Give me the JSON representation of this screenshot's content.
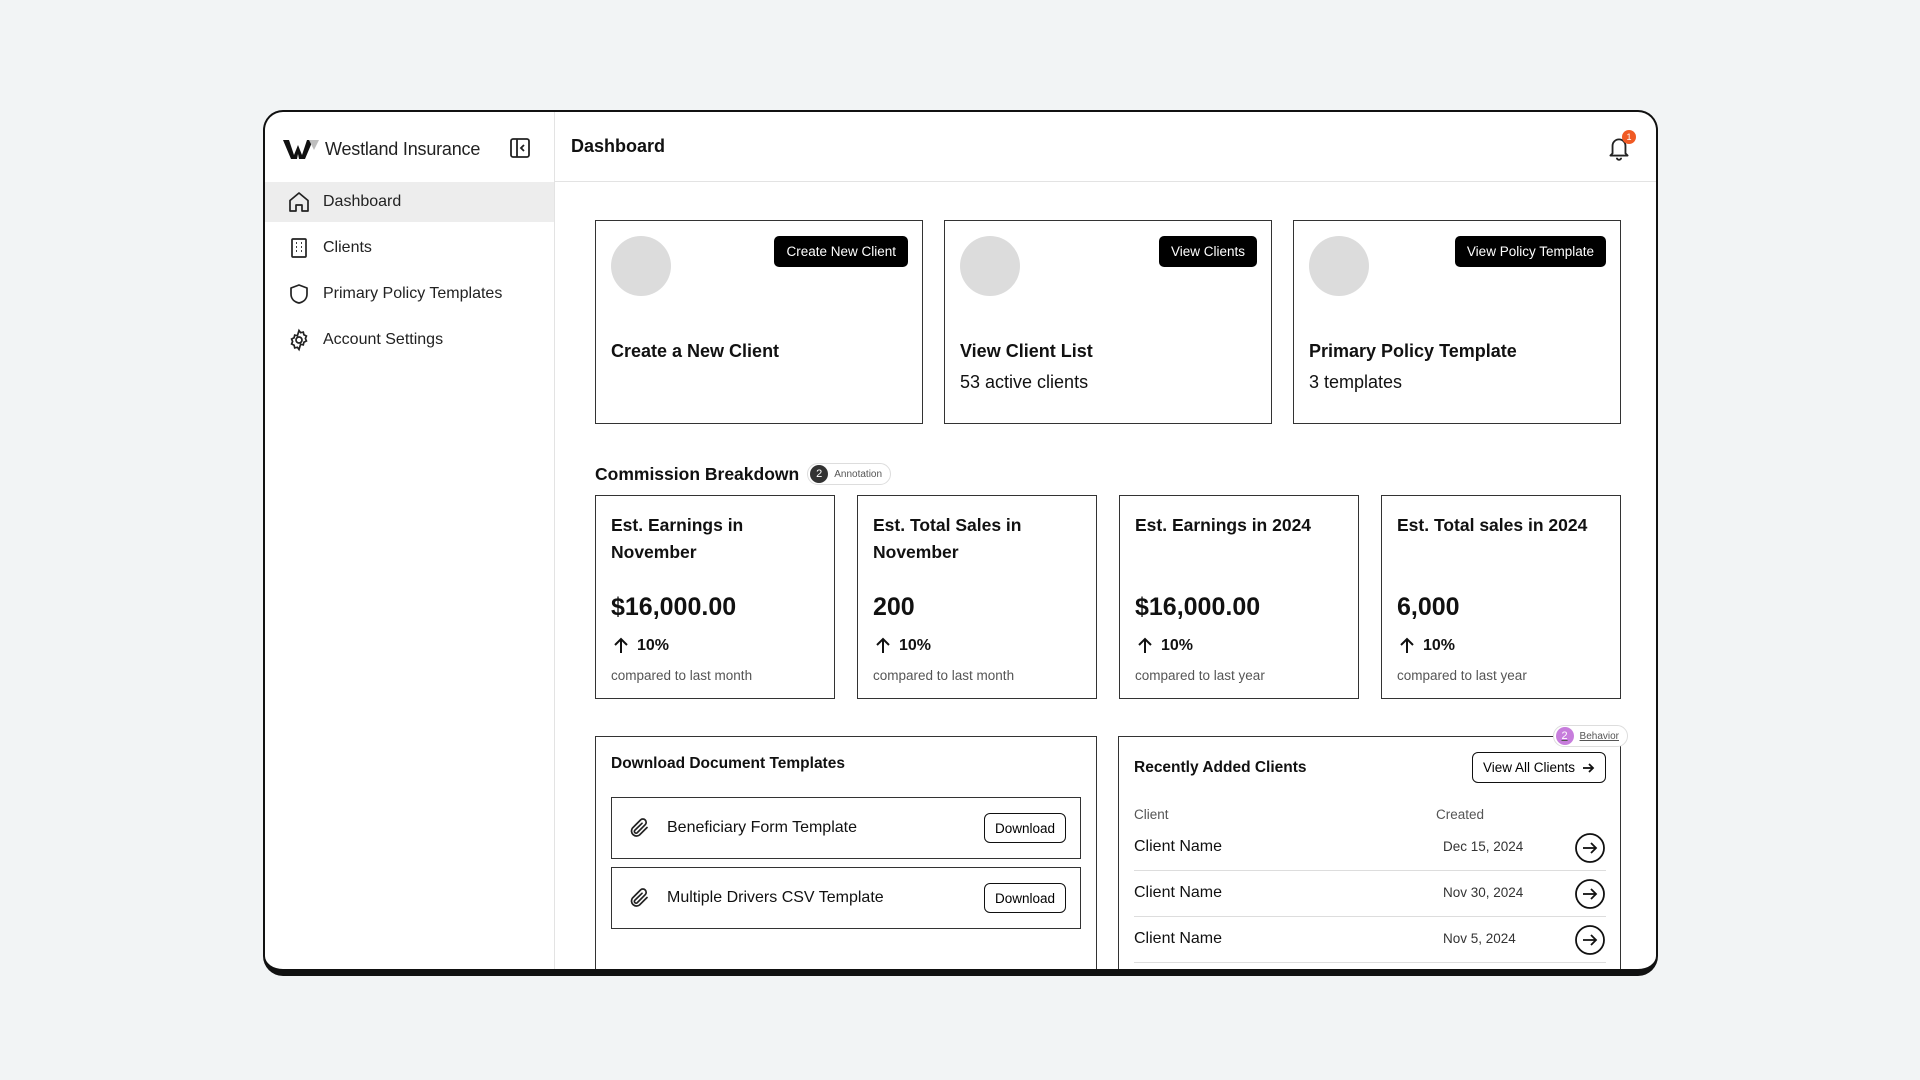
{
  "brand": {
    "name": "Westland Insurance"
  },
  "sidebar": {
    "items": [
      {
        "label": "Dashboard",
        "icon": "home-icon",
        "active": true
      },
      {
        "label": "Clients",
        "icon": "building-icon",
        "active": false
      },
      {
        "label": "Primary Policy Templates",
        "icon": "shield-icon",
        "active": false
      },
      {
        "label": "Account Settings",
        "icon": "gear-icon",
        "active": false
      }
    ]
  },
  "header": {
    "title": "Dashboard",
    "notification_count": "1"
  },
  "quick_cards": [
    {
      "button": "Create New Client",
      "title": "Create a New Client",
      "subtitle": ""
    },
    {
      "button": "View Clients",
      "title": "View Client List",
      "subtitle": "53 active clients"
    },
    {
      "button": "View Policy Template",
      "title": "Primary Policy Template",
      "subtitle": "3 templates"
    }
  ],
  "commission": {
    "title": "Commission Breakdown",
    "annotation": {
      "number": "2",
      "label": "Annotation"
    },
    "stats": [
      {
        "label": "Est. Earnings in November",
        "value": "$16,000.00",
        "trend": "10%",
        "note": "compared to last month"
      },
      {
        "label": "Est. Total Sales in November",
        "value": "200",
        "trend": "10%",
        "note": "compared to last month"
      },
      {
        "label": "Est. Earnings in 2024",
        "value": "$16,000.00",
        "trend": "10%",
        "note": "compared to last year"
      },
      {
        "label": "Est. Total sales in 2024",
        "value": "6,000",
        "trend": "10%",
        "note": "compared to last year"
      }
    ]
  },
  "documents": {
    "title": "Download Document Templates",
    "items": [
      {
        "name": "Beneficiary Form Template",
        "button": "Download"
      },
      {
        "name": "Multiple Drivers CSV Template",
        "button": "Download"
      }
    ]
  },
  "recent_clients": {
    "title": "Recently Added Clients",
    "view_all": "View All Clients",
    "behavior": {
      "number": "2",
      "label": "Behavior"
    },
    "columns": {
      "client": "Client",
      "created": "Created"
    },
    "rows": [
      {
        "name": "Client Name",
        "created": "Dec 15, 2024"
      },
      {
        "name": "Client Name",
        "created": "Nov 30, 2024"
      },
      {
        "name": "Client Name",
        "created": "Nov 5, 2024"
      }
    ]
  },
  "colors": {
    "accent": "#000000",
    "badge": "#f05a24",
    "behavior": "#c77ddc",
    "active_nav": "#ededed"
  }
}
